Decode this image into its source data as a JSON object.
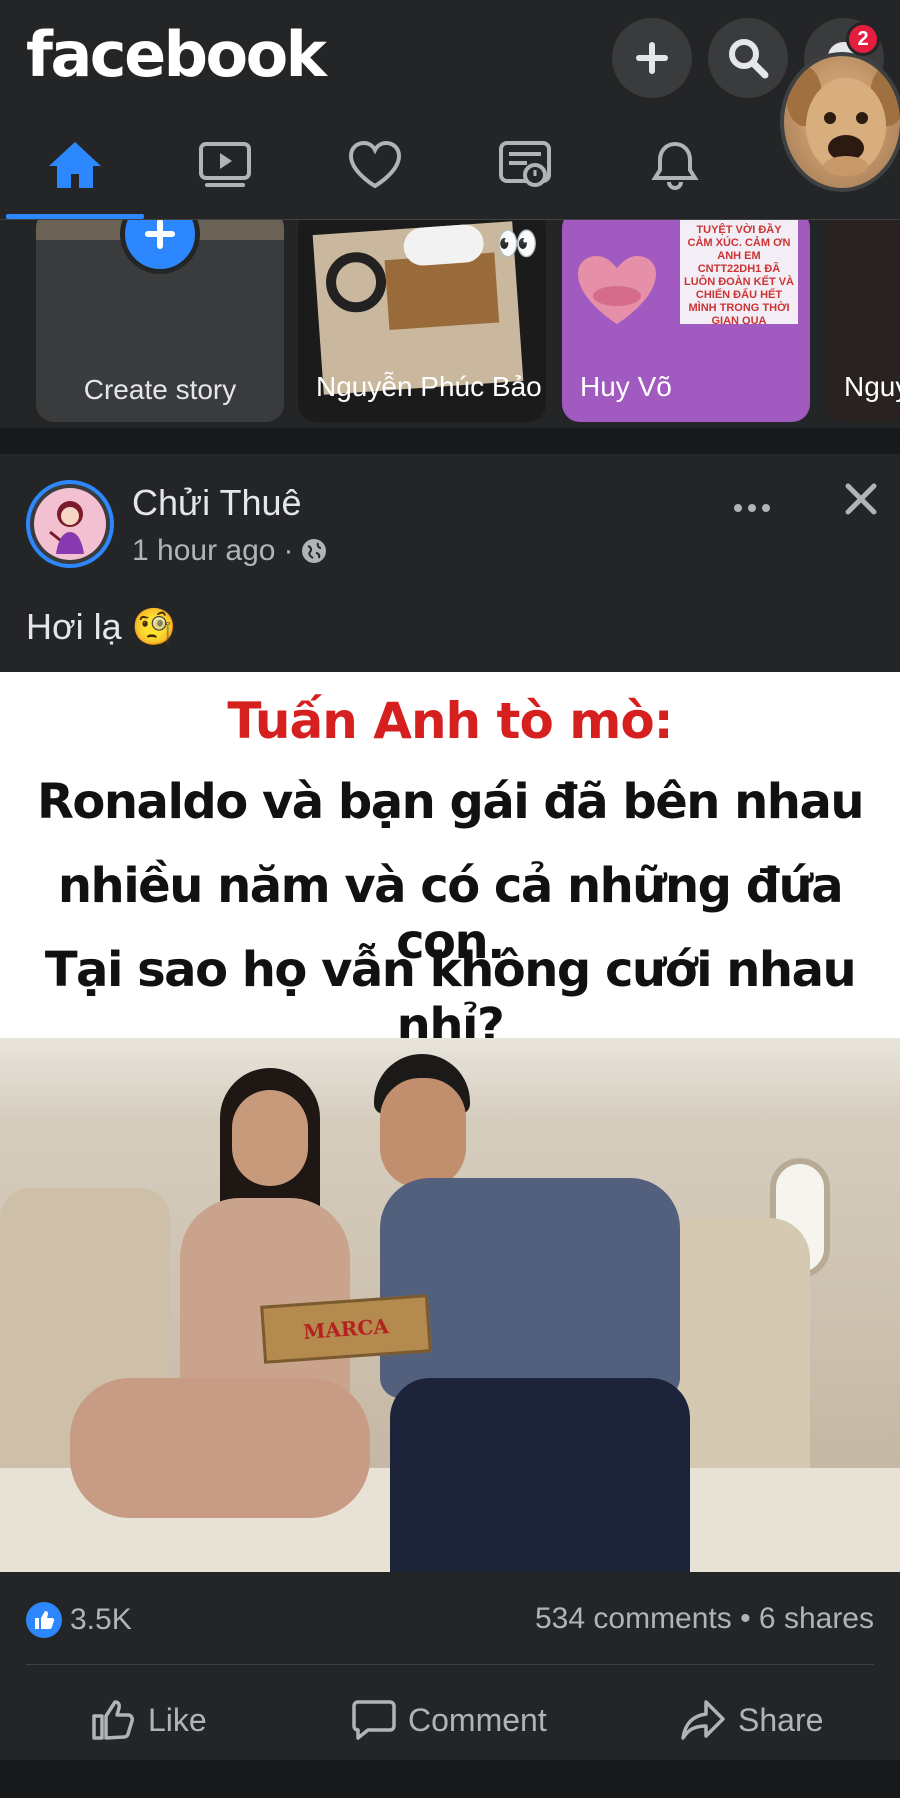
{
  "app": {
    "logo_text": "facebook",
    "notification_badge": "2",
    "accent_color": "#2d88ff",
    "background_color": "#242526"
  },
  "header": {
    "icons": [
      "plus-icon",
      "search-icon",
      "messenger-icon"
    ]
  },
  "tabs": [
    {
      "name": "home",
      "icon": "home-icon",
      "active": true
    },
    {
      "name": "watch",
      "icon": "video-icon",
      "active": false
    },
    {
      "name": "dating",
      "icon": "heart-icon",
      "active": false
    },
    {
      "name": "news",
      "icon": "newspaper-icon",
      "active": false
    },
    {
      "name": "notifications",
      "icon": "bell-icon",
      "active": false
    },
    {
      "name": "menu",
      "icon": "profile-avatar",
      "active": false
    }
  ],
  "stories": {
    "create_label": "Create story",
    "items": [
      {
        "name": "Nguyễn Phúc Bảo"
      },
      {
        "name": "Huy Võ",
        "text": "TUYỆT VỜI ĐẦY CẢM XÚC. CẢM ƠN ANH EM CNTT22DH1 ĐÃ LUÔN ĐOÀN KẾT VÀ CHIẾN ĐẤU HẾT MÌNH TRONG THỜI GIAN QUA"
      },
      {
        "name": "Nguy… Bửu"
      }
    ]
  },
  "post": {
    "author": "Chửi Thuê",
    "time": "1 hour ago",
    "dot": "·",
    "privacy_icon": "globe-icon",
    "text": "Hơi lạ 🧐",
    "image": {
      "headline": "Tuấn Anh tò mò:",
      "line1": "Ronaldo và bạn gái đã bên nhau",
      "line2": "nhiều năm và có cả những đứa con.",
      "line3": "Tại sao họ vẫn không cưới nhau nhỉ?",
      "box_text": "MARCA"
    },
    "reactions_count": "3.5K",
    "counts_text": "534 comments • 6 shares",
    "actions": {
      "like": "Like",
      "comment": "Comment",
      "share": "Share"
    }
  }
}
